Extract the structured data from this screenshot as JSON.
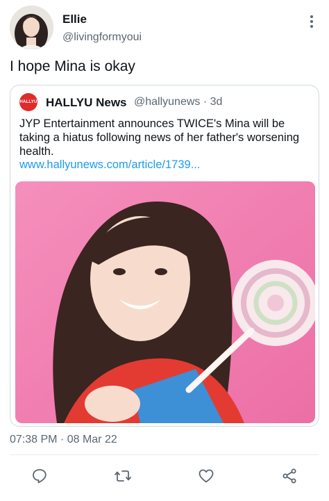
{
  "tweet": {
    "author_name": "Ellie",
    "author_handle": "@livingformyoui",
    "text": "I hope Mina is okay",
    "timestamp": "07:38 PM · 08 Mar 22"
  },
  "quoted_tweet": {
    "logo_text": "HALLYU",
    "author_name": "HALLYU News",
    "author_handle": "@hallyunews",
    "age": "3d",
    "text": "JYP Entertainment announces TWICE's Mina will be taking a hiatus following news of her father's worsening health.",
    "link": "www.hallyunews.com/article/1739..."
  },
  "colors": {
    "link": "#1d9bf0",
    "secondary_text": "#5b6670",
    "logo_red": "#e02b2b",
    "image_background_pink": "#f07fb0"
  },
  "icons": {
    "more": "more-vertical-icon",
    "reply": "reply-icon",
    "retweet": "retweet-icon",
    "like": "heart-icon",
    "share": "share-icon"
  }
}
